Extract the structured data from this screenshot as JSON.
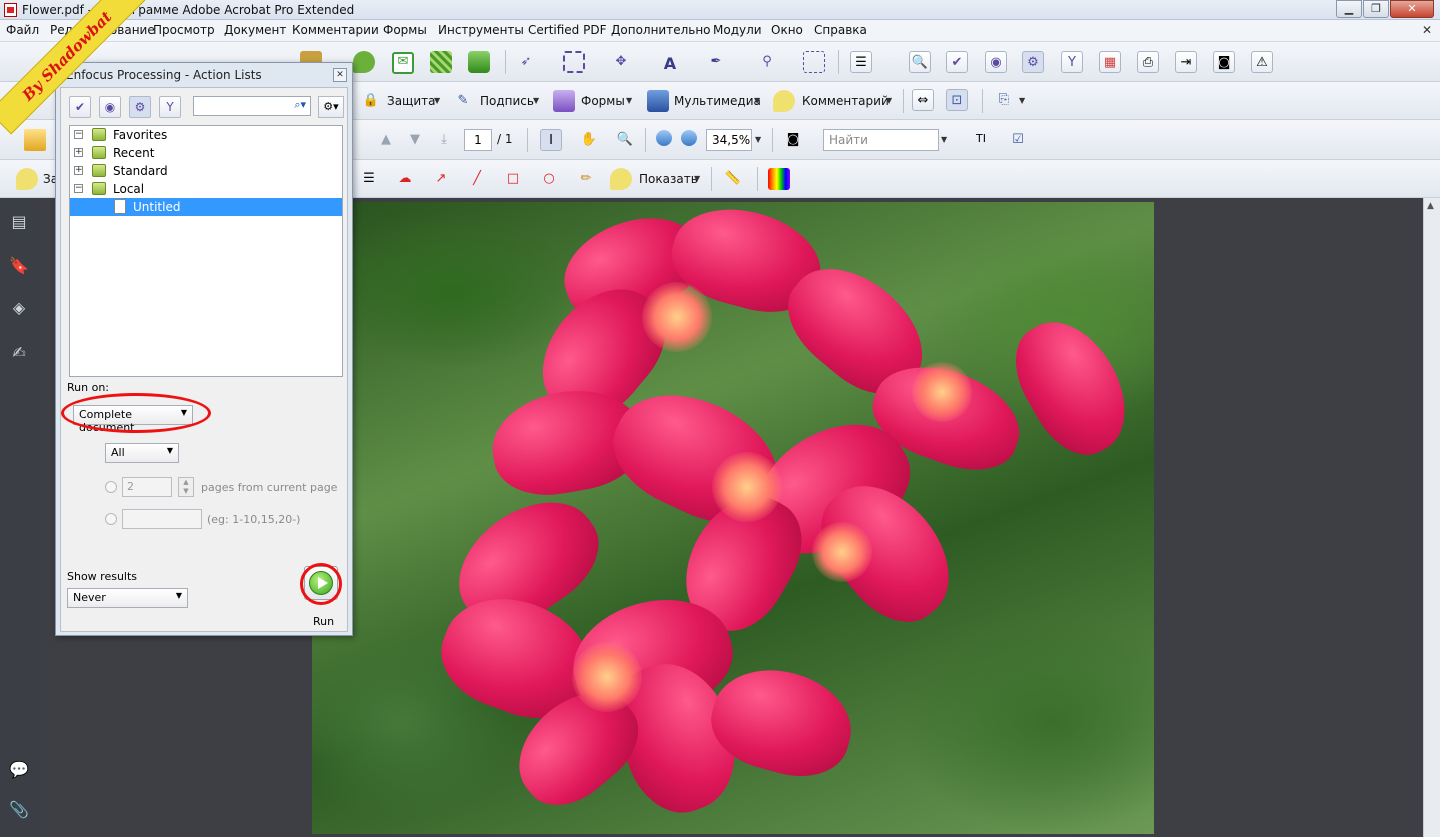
{
  "window": {
    "title": "Flower.pdf - О программе Adobe Acrobat Pro Extended"
  },
  "menu": {
    "items": [
      "Файл",
      "Редактирование",
      "Просмотр",
      "Документ",
      "Комментарии",
      "Формы",
      "Инструменты",
      "Certified PDF",
      "Дополнительно",
      "Модули",
      "Окно",
      "Справка"
    ]
  },
  "toolbar2": {
    "protect_label": "Защита",
    "sign_label": "Подпись",
    "forms_label": "Формы",
    "multimedia_label": "Мультимедиа",
    "comment_label": "Комментарий"
  },
  "toolbar3": {
    "page_current": "1",
    "page_total": "/ 1",
    "zoom": "34,5%",
    "find_placeholder": "Найти"
  },
  "toolbar4": {
    "comment_partial": "За",
    "show_label": "Показать"
  },
  "watermark": {
    "text": "By Shadowbat"
  },
  "dialog": {
    "title": "Enfocus Processing - Action Lists",
    "tree": [
      {
        "label": "Favorites",
        "expander": "−"
      },
      {
        "label": "Recent",
        "expander": "+"
      },
      {
        "label": "Standard",
        "expander": "+"
      },
      {
        "label": "Local",
        "expander": "−"
      },
      {
        "label": "Untitled",
        "expander": ""
      }
    ],
    "run_on_label": "Run on:",
    "run_on_value": "Complete document",
    "pages_value": "All",
    "pages_from_value": "2",
    "pages_from_label": "pages from current page",
    "range_hint": "(eg: 1-10,15,20-)",
    "show_results_label": "Show results",
    "show_results_value": "Never",
    "run_label": "Run"
  },
  "colors": {
    "highlight": "#e11",
    "selection": "#3399ff",
    "watermark_bg": "#f2dc3a"
  }
}
